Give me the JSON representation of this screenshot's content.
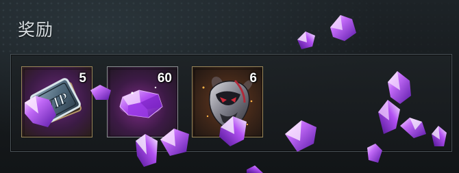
{
  "header": {
    "title": "奖励"
  },
  "rewards": [
    {
      "name": "vip-card",
      "icon": "vip-card-icon",
      "quantity": "5",
      "frame_color": "#9a8759"
    },
    {
      "name": "purple-gem",
      "icon": "purple-gem-icon",
      "quantity": "60",
      "frame_color": "#8a8f90"
    },
    {
      "name": "demon-mask",
      "icon": "demon-mask-icon",
      "quantity": "6",
      "frame_color": "#9a8759"
    }
  ],
  "colors": {
    "gem_purple": "#9b3cf0",
    "gem_highlight": "#f3d8ff",
    "panel_border": "#4a5257",
    "title_text": "#d7dde0"
  }
}
